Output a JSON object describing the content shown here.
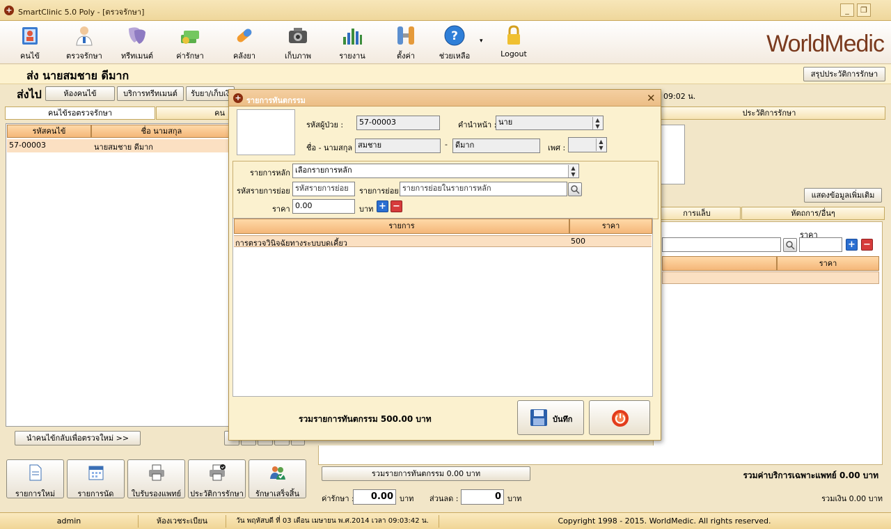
{
  "window": {
    "title": "SmartClinic 5.0 Poly - [ตรวจรักษา]",
    "controls": [
      "_",
      "❐"
    ]
  },
  "toolbar": {
    "items": [
      {
        "label": "คนไข้",
        "icon": "patient-book-icon"
      },
      {
        "label": "ตรวจรักษา",
        "icon": "doctor-icon"
      },
      {
        "label": "ทรีทเมนต์",
        "icon": "mask-icon"
      },
      {
        "label": "ค่ารักษา",
        "icon": "money-icon"
      },
      {
        "label": "คลังยา",
        "icon": "pill-icon"
      },
      {
        "label": "เก็บภาพ",
        "icon": "camera-icon"
      },
      {
        "label": "รายงาน",
        "icon": "chart-icon"
      },
      {
        "label": "ตั้งค่า",
        "icon": "tools-icon"
      },
      {
        "label": "ช่วยเหลือ",
        "icon": "help-icon"
      },
      {
        "label": "Logout",
        "icon": "lock-icon"
      }
    ],
    "brand": "WorldMedic"
  },
  "patient_bar": {
    "title": "ส่ง  นายสมชาย ดีมาก",
    "history_summary_button": "สรุปประวัติการรักษา"
  },
  "sendto": {
    "label": "ส่งไป",
    "buttons": [
      "ห้องคนไข้",
      "บริการทรีทเมนต์",
      "รับยา/เก็บเงิ"
    ],
    "time_fragment": "09:02 น."
  },
  "left": {
    "tabs": [
      "คนไข้รอตรวจรักษา",
      "คน"
    ],
    "columns": [
      "รหัสคนไข้",
      "ชื่อ นามสกุล"
    ],
    "rows": [
      {
        "code": "57-00003",
        "name": "นายสมชาย ดีมาก"
      }
    ],
    "return_button": "นำคนไข้กลับเพื่อตรวจใหม่ >>"
  },
  "right": {
    "history_tab": "ประวัติการรักษา",
    "show_more_button": "แสดงข้อมูลเพิ่มเติม",
    "subtabs": [
      "การแล็บ",
      "หัตถการ/อื่นๆ"
    ],
    "price_label": "ราคา",
    "price_column": "ราคา",
    "proc_total_button": "รวมรายการทันตกรรม 0.00 บาท",
    "doctor_fee_total": "รวมค่าบริการเฉพาะแพทย์ 0.00 บาท"
  },
  "footer_totals": {
    "fee_label": "ค่ารักษา :",
    "fee_value": "0.00",
    "baht1": "บาท",
    "discount_label": "ส่วนลด :",
    "discount_value": "0",
    "baht2": "บาท",
    "grand_total": "รวมเงิน 0.00 บาท"
  },
  "bottom_buttons": [
    {
      "label": "รายการใหม่",
      "icon": "document-icon"
    },
    {
      "label": "รายการนัด",
      "icon": "calendar-icon"
    },
    {
      "label": "ใบรับรองแพทย์",
      "icon": "printer-icon"
    },
    {
      "label": "ประวัติการรักษา",
      "icon": "printer-check-icon"
    },
    {
      "label": "รักษาเสร็จสิ้น",
      "icon": "users-check-icon"
    }
  ],
  "status": {
    "user": "admin",
    "room": "ห้องเวชระเบียน",
    "datetime": "วัน พฤหัสบดี ที่ 03 เดือน เมษายน พ.ศ.2014 เวลา 09:03:42 น.",
    "copyright": "Copyright 1998 - 2015. WorldMedic. All rights reserved."
  },
  "dialog": {
    "title": "รายการทันตกรรม",
    "patient_id_label": "รหัสผู้ป่วย :",
    "patient_id": "57-00003",
    "prefix_label": "คำนำหน้า :",
    "prefix": "นาย",
    "name_label": "ชื่อ - นามสกุล :",
    "first_name": "สมชาย",
    "dash": "-",
    "last_name": "ดีมาก",
    "sex_label": "เพศ :",
    "sex": "",
    "main_item_label": "รายการหลัก",
    "main_item": "เลือกรายการหลัก",
    "sub_code_label": "รหัสรายการย่อย",
    "sub_code": "รหัสรายการย่อย",
    "sub_item_label": "รายการย่อย",
    "sub_item": "รายการย่อยในรายการหลัก",
    "price_label": "ราคา",
    "price": "0.00",
    "baht": "บาท",
    "columns": [
      "รายการ",
      "ราคา"
    ],
    "rows": [
      {
        "item": "การตรวจวินิจฉัยทางระบบบดเคี้ยว",
        "price": "500"
      }
    ],
    "total": "รวมรายการทันตกรรม 500.00 บาท",
    "save_button": "บันทึก"
  }
}
